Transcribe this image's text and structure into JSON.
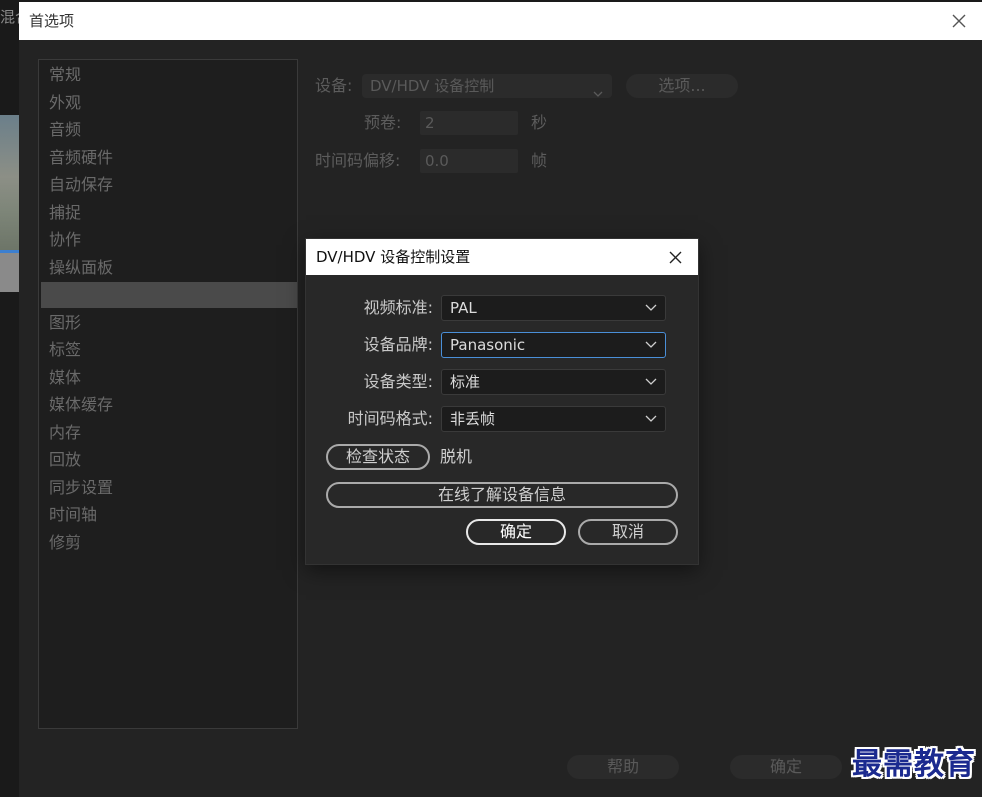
{
  "background_app": {
    "title_fragment": "混合"
  },
  "preferences": {
    "window_title": "首选项",
    "sidebar": {
      "items": [
        {
          "label": "常规"
        },
        {
          "label": "外观"
        },
        {
          "label": "音频"
        },
        {
          "label": "音频硬件"
        },
        {
          "label": "自动保存"
        },
        {
          "label": "捕捉"
        },
        {
          "label": "协作"
        },
        {
          "label": "操纵面板"
        },
        {
          "label": ""
        },
        {
          "label": "图形"
        },
        {
          "label": "标签"
        },
        {
          "label": "媒体"
        },
        {
          "label": "媒体缓存"
        },
        {
          "label": "内存"
        },
        {
          "label": "回放"
        },
        {
          "label": "同步设置"
        },
        {
          "label": "时间轴"
        },
        {
          "label": "修剪"
        }
      ],
      "selected_index": 8
    },
    "device": {
      "label": "设备:",
      "value": "DV/HDV 设备控制",
      "options_button": "选项..."
    },
    "preroll": {
      "label": "预卷:",
      "value": "2",
      "unit": "秒"
    },
    "timecode_offset": {
      "label": "时间码偏移:",
      "value": "0.0",
      "unit": "帧"
    },
    "footer": {
      "help_button": "帮助",
      "ok_button": "确定"
    }
  },
  "dialog": {
    "title": "DV/HDV 设备控制设置",
    "fields": {
      "video_standard": {
        "label": "视频标准:",
        "value": "PAL"
      },
      "device_brand": {
        "label": "设备品牌:",
        "value": "Panasonic"
      },
      "device_type": {
        "label": "设备类型:",
        "value": "标准"
      },
      "timecode_format": {
        "label": "时间码格式:",
        "value": "非丢帧"
      }
    },
    "check_status_button": "检查状态",
    "status_value": "脱机",
    "online_info_button": "在线了解设备信息",
    "ok_button": "确定",
    "cancel_button": "取消"
  },
  "watermark": "最需教育"
}
